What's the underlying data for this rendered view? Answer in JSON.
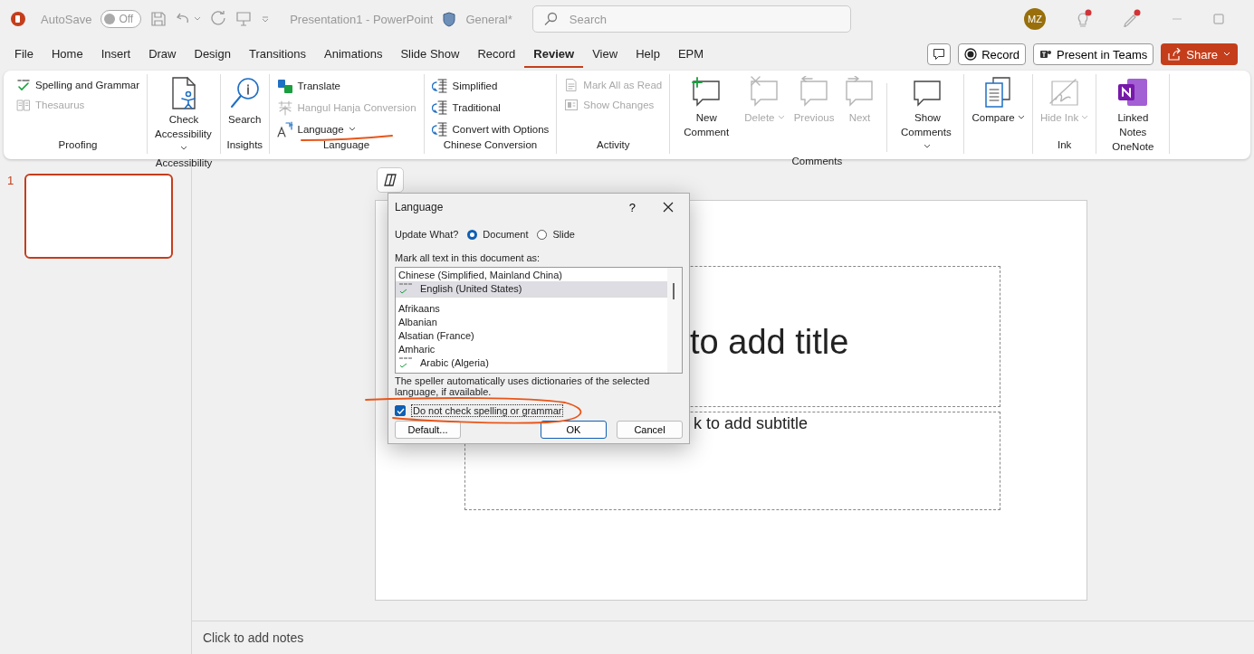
{
  "title_bar": {
    "autosave_label": "AutoSave",
    "autosave": {
      "on": false,
      "text": "Off"
    },
    "document_title": "Presentation1  -  PowerPoint",
    "sensitivity": "General*",
    "search": {
      "placeholder": "Search"
    },
    "avatar": "MZ"
  },
  "tabs": [
    {
      "label": "File",
      "selected": false
    },
    {
      "label": "Home",
      "selected": false
    },
    {
      "label": "Insert",
      "selected": false
    },
    {
      "label": "Draw",
      "selected": false
    },
    {
      "label": "Design",
      "selected": false
    },
    {
      "label": "Transitions",
      "selected": false
    },
    {
      "label": "Animations",
      "selected": false
    },
    {
      "label": "Slide Show",
      "selected": false
    },
    {
      "label": "Record",
      "selected": false
    },
    {
      "label": "Review",
      "selected": true
    },
    {
      "label": "View",
      "selected": false
    },
    {
      "label": "Help",
      "selected": false
    },
    {
      "label": "EPM",
      "selected": false
    }
  ],
  "tab_actions": {
    "record": "Record",
    "present": "Present in Teams",
    "share": "Share"
  },
  "ribbon": [
    {
      "label": "Proofing",
      "items": [
        {
          "kind": "small",
          "label": "Spelling and Grammar",
          "disabled": false,
          "dropdown": false
        },
        {
          "kind": "small",
          "label": "Thesaurus",
          "disabled": true,
          "dropdown": false
        }
      ]
    },
    {
      "label": "Accessibility",
      "items": [
        {
          "kind": "large",
          "label": "Check Accessibility",
          "disabled": false,
          "dropdown": true
        }
      ]
    },
    {
      "label": "Insights",
      "items": [
        {
          "kind": "large",
          "label": "Search",
          "disabled": false,
          "dropdown": false
        }
      ]
    },
    {
      "label": "Language",
      "items": [
        {
          "kind": "small",
          "label": "Translate",
          "disabled": false,
          "dropdown": false
        },
        {
          "kind": "small",
          "label": "Hangul Hanja Conversion",
          "disabled": true,
          "dropdown": false
        },
        {
          "kind": "small",
          "label": "Language",
          "disabled": false,
          "dropdown": true
        }
      ]
    },
    {
      "label": "Chinese Conversion",
      "items": [
        {
          "kind": "small",
          "label": "Simplified",
          "disabled": false,
          "dropdown": false
        },
        {
          "kind": "small",
          "label": "Traditional",
          "disabled": false,
          "dropdown": false
        },
        {
          "kind": "small",
          "label": "Convert with Options",
          "disabled": false,
          "dropdown": false
        }
      ]
    },
    {
      "label": "Activity",
      "items": [
        {
          "kind": "small",
          "label": "Mark All as Read",
          "disabled": true,
          "dropdown": false
        },
        {
          "kind": "small",
          "label": "Show Changes",
          "disabled": true,
          "dropdown": false
        }
      ]
    },
    {
      "label": "Comments",
      "items": [
        {
          "kind": "large",
          "label": "New Comment",
          "disabled": false,
          "dropdown": false
        },
        {
          "kind": "large",
          "label": "Delete",
          "disabled": true,
          "dropdown": true
        },
        {
          "kind": "large",
          "label": "Previous",
          "disabled": true,
          "dropdown": false
        },
        {
          "kind": "large",
          "label": "Next",
          "disabled": true,
          "dropdown": false
        },
        {
          "kind": "large",
          "label": "Show Comments",
          "disabled": false,
          "dropdown": true
        }
      ]
    },
    {
      "items": [
        {
          "kind": "large",
          "label": "Compare",
          "disabled": false,
          "dropdown": true
        }
      ]
    },
    {
      "label": "Ink",
      "items": [
        {
          "kind": "large",
          "label": "Hide Ink",
          "disabled": true,
          "dropdown": true
        }
      ]
    },
    {
      "label": "OneNote",
      "items": [
        {
          "kind": "large",
          "label": "Linked Notes",
          "disabled": false,
          "dropdown": false
        }
      ]
    }
  ],
  "thumbnails": [
    {
      "number": "1",
      "selected": true
    }
  ],
  "slide": {
    "title": "to add title",
    "subtitle": "k to add subtitle"
  },
  "notes": {
    "placeholder": "Click to add notes"
  },
  "dialog": {
    "title": "Language",
    "help": "?",
    "update_label": "Update What?",
    "scope": [
      {
        "label": "Document",
        "selected": true
      },
      {
        "label": "Slide",
        "selected": false
      }
    ],
    "list_label": "Mark all text in this document as:",
    "languages": [
      {
        "label": "Chinese (Simplified, Mainland China)",
        "spell_check": false,
        "pinned": true,
        "selected": false
      },
      {
        "label": "English (United States)",
        "spell_check": true,
        "pinned": true,
        "selected": true
      },
      {
        "label": "Afrikaans",
        "spell_check": false,
        "pinned": false,
        "selected": false
      },
      {
        "label": "Albanian",
        "spell_check": false,
        "pinned": false,
        "selected": false
      },
      {
        "label": "Alsatian (France)",
        "spell_check": false,
        "pinned": false,
        "selected": false
      },
      {
        "label": "Amharic",
        "spell_check": false,
        "pinned": false,
        "selected": false
      },
      {
        "label": "Arabic (Algeria)",
        "spell_check": true,
        "pinned": false,
        "selected": false
      }
    ],
    "note": "The speller automatically uses dictionaries of the selected language, if available.",
    "no_check": {
      "label": "Do not check spelling or grammar",
      "checked": true
    },
    "buttons": [
      {
        "label": "Default...",
        "default": false
      },
      {
        "label": "OK",
        "default": true
      },
      {
        "label": "Cancel",
        "default": false
      }
    ]
  }
}
